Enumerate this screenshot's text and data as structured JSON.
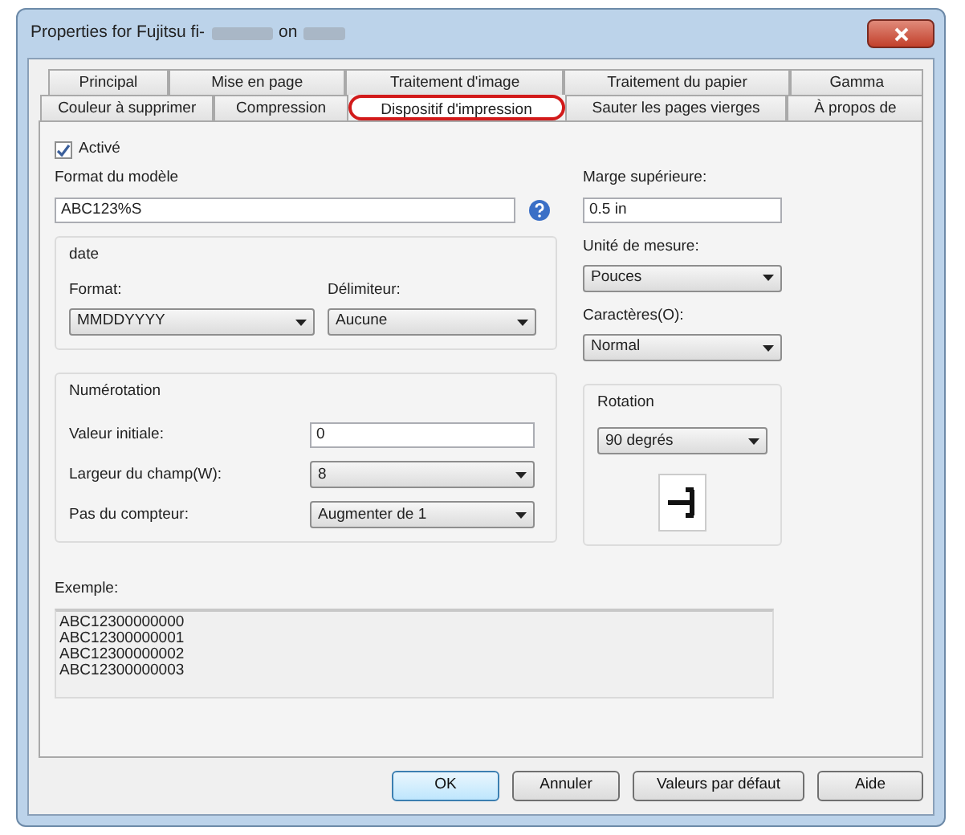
{
  "window": {
    "title": "Properties for Fujitsu fi-",
    "title_suffix": "on"
  },
  "tab_rows": [
    [
      {
        "label": "Principal",
        "selected": false
      },
      {
        "label": "Mise en page",
        "selected": false
      },
      {
        "label": "Traitement d'image",
        "selected": false
      },
      {
        "label": "Traitement du papier",
        "selected": false
      },
      {
        "label": "Gamma",
        "selected": false
      }
    ],
    [
      {
        "label": "Couleur à supprimer",
        "selected": false
      },
      {
        "label": "Compression",
        "selected": false
      },
      {
        "label": "Dispositif d'impression",
        "selected": true
      },
      {
        "label": "Sauter les pages vierges",
        "selected": false
      },
      {
        "label": "À propos de",
        "selected": false
      }
    ]
  ],
  "enabled": {
    "label": "Activé",
    "checked": true
  },
  "template": {
    "label": "Format du modèle",
    "value": "ABC123%S"
  },
  "date": {
    "title": "date",
    "format": {
      "label": "Format:",
      "value": "MMDDYYYY"
    },
    "delimiter": {
      "label": "Délimiteur:",
      "value": "Aucune"
    }
  },
  "numbering": {
    "title": "Numérotation",
    "rows": [
      {
        "label": "Valeur initiale:",
        "kind": "input",
        "value": "0"
      },
      {
        "label": "Largeur du champ(W):",
        "kind": "select",
        "value": "8"
      },
      {
        "label": "Pas du compteur:",
        "kind": "select",
        "value": "Augmenter de 1"
      }
    ]
  },
  "margin": {
    "label": "Marge supérieure:",
    "value": "0.5 in"
  },
  "unit": {
    "label": "Unité de mesure:",
    "value": "Pouces"
  },
  "characters": {
    "label": "Caractères(O):",
    "value": "Normal"
  },
  "rotation": {
    "title": "Rotation",
    "value": "90 degrés"
  },
  "example": {
    "label": "Exemple:",
    "lines": [
      "ABC12300000000",
      "ABC12300000001",
      "ABC12300000002",
      "ABC12300000003"
    ]
  },
  "buttons": [
    {
      "label": "OK",
      "default": true
    },
    {
      "label": "Annuler",
      "default": false
    },
    {
      "label": "Valeurs par défaut",
      "default": false
    },
    {
      "label": "Aide",
      "default": false
    }
  ]
}
